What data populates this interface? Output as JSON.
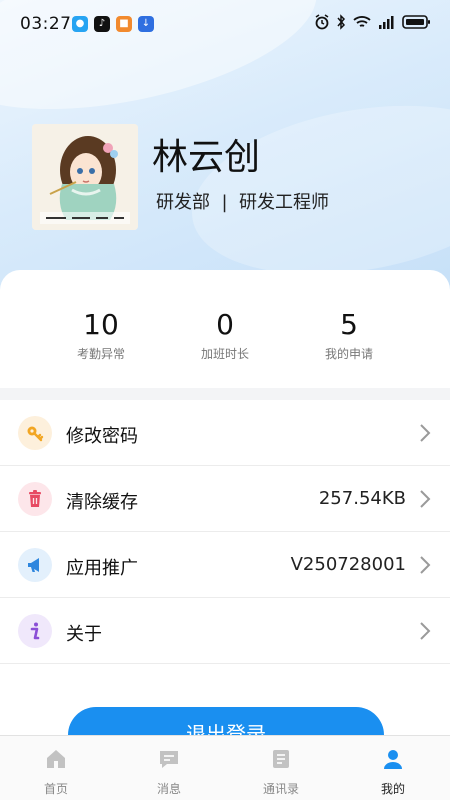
{
  "status_bar": {
    "time": "03:27",
    "battery_color": "#111111"
  },
  "profile": {
    "name": "林云创",
    "department_line": "研发部  |  研发工程师"
  },
  "stats": [
    {
      "value": "10",
      "label": "考勤异常"
    },
    {
      "value": "0",
      "label": "加班时长"
    },
    {
      "value": "5",
      "label": "我的申请"
    }
  ],
  "menu": [
    {
      "label": "修改密码",
      "value": "",
      "icon": "key-icon"
    },
    {
      "label": "清除缓存",
      "value": "257.54KB",
      "icon": "trash-icon"
    },
    {
      "label": "应用推广",
      "value": "V250728001",
      "icon": "megaphone-icon"
    },
    {
      "label": "关于",
      "value": "",
      "icon": "info-icon"
    }
  ],
  "logout_label": "退出登录",
  "tabs": [
    {
      "label": "首页",
      "icon": "home-icon",
      "active": false
    },
    {
      "label": "消息",
      "icon": "message-icon",
      "active": false
    },
    {
      "label": "通讯录",
      "icon": "contacts-icon",
      "active": false
    },
    {
      "label": "我的",
      "icon": "user-icon",
      "active": true
    }
  ],
  "colors": {
    "primary": "#1a8ff0",
    "tab_inactive": "#bdbdbd"
  }
}
